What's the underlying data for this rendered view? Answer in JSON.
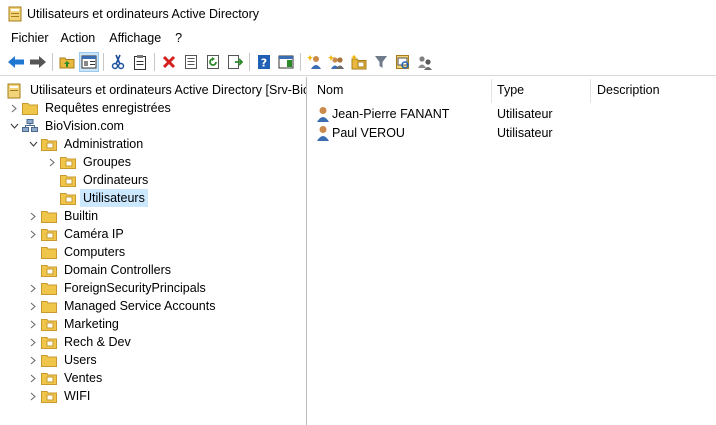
{
  "window": {
    "title": "Utilisateurs et ordinateurs Active Directory"
  },
  "menu": [
    "Fichier",
    "Action",
    "Affichage",
    "?"
  ],
  "toolbar": {
    "buttons": [
      "back-icon",
      "forward-icon",
      "up-folder-icon",
      "show-hide-tree-icon",
      "cut-icon",
      "paste-icon",
      "delete-icon",
      "properties-icon",
      "refresh-icon",
      "export-list-icon",
      "help-icon",
      "action-pane-icon",
      "new-user-icon",
      "new-group-icon",
      "new-ou-icon",
      "filter-icon",
      "find-icon",
      "delegate-icon"
    ]
  },
  "tree": {
    "root": "Utilisateurs et ordinateurs Active Directory [Srv-Bio.B",
    "saved_queries": "Requêtes enregistrées",
    "domain": "BioVision.com",
    "administration": "Administration",
    "groupes": "Groupes",
    "ordinateurs": "Ordinateurs",
    "utilisateurs": "Utilisateurs",
    "ous": [
      "Builtin",
      "Caméra IP",
      "Computers",
      "Domain Controllers",
      "ForeignSecurityPrincipals",
      "Managed Service Accounts",
      "Marketing",
      "Rech & Dev",
      "Users",
      "Ventes",
      "WIFI"
    ]
  },
  "list": {
    "columns": {
      "name": "Nom",
      "type": "Type",
      "description": "Description"
    },
    "rows": [
      {
        "name": "Jean-Pierre FANANT",
        "type": "Utilisateur",
        "description": ""
      },
      {
        "name": "Paul VEROU",
        "type": "Utilisateur",
        "description": ""
      }
    ]
  },
  "colors": {
    "folder": "#f0c64a",
    "selection": "#cce8ff",
    "toolbar_active": "#cce4f7"
  }
}
